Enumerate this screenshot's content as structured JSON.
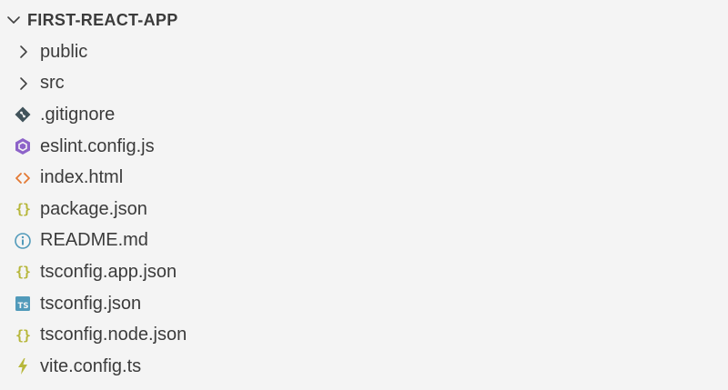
{
  "explorer": {
    "root_title": "FIRST-REACT-APP",
    "root_icon": "chevron-down-icon",
    "items": [
      {
        "label": "public",
        "kind": "folder",
        "icon": "chevron-right-icon"
      },
      {
        "label": "src",
        "kind": "folder",
        "icon": "chevron-right-icon"
      },
      {
        "label": ".gitignore",
        "kind": "file",
        "icon": "git-icon",
        "icon_color": "#41535b"
      },
      {
        "label": "eslint.config.js",
        "kind": "file",
        "icon": "eslint-icon",
        "icon_color": "#8d63c9"
      },
      {
        "label": "index.html",
        "kind": "file",
        "icon": "html-icon",
        "icon_color": "#e37933"
      },
      {
        "label": "package.json",
        "kind": "file",
        "icon": "json-icon",
        "icon_color": "#b7b73b"
      },
      {
        "label": "README.md",
        "kind": "file",
        "icon": "info-icon",
        "icon_color": "#519aba"
      },
      {
        "label": "tsconfig.app.json",
        "kind": "file",
        "icon": "json-icon",
        "icon_color": "#b7b73b"
      },
      {
        "label": "tsconfig.json",
        "kind": "file",
        "icon": "typescript-icon",
        "icon_color": "#519aba"
      },
      {
        "label": "tsconfig.node.json",
        "kind": "file",
        "icon": "json-icon",
        "icon_color": "#b7b73b"
      },
      {
        "label": "vite.config.ts",
        "kind": "file",
        "icon": "vite-icon",
        "icon_color": "#b7b73b"
      }
    ]
  }
}
